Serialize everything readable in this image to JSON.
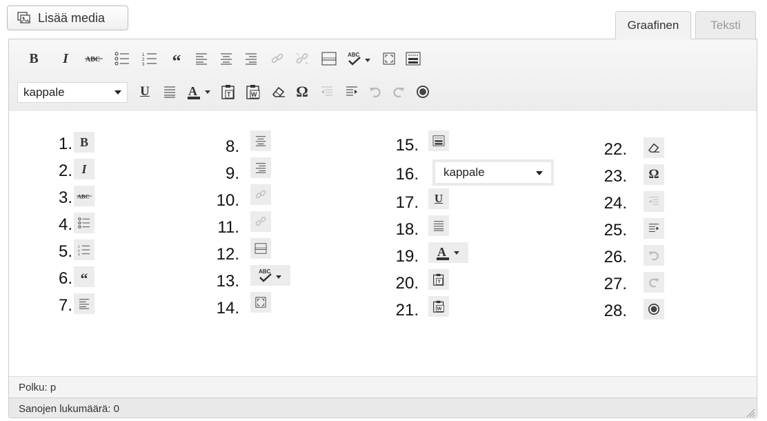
{
  "media_button": {
    "label": "Lisää media",
    "icon": "add-media-icon"
  },
  "tabs": [
    {
      "label": "Graafinen",
      "active": true
    },
    {
      "label": "Teksti",
      "active": false
    }
  ],
  "toolbar": {
    "row1": [
      "bold-icon",
      "italic-icon",
      "strikethrough-icon",
      "bullet-list-icon",
      "numbered-list-icon",
      "blockquote-icon",
      "align-left-icon",
      "align-center-icon",
      "align-right-icon",
      "link-icon",
      "unlink-icon",
      "more-tag-icon",
      "spellcheck-icon",
      "fullscreen-icon",
      "toolbar-toggle-icon"
    ],
    "row2": [
      "format-select",
      "underline-icon",
      "justify-icon",
      "text-color-icon",
      "paste-text-icon",
      "paste-word-icon",
      "clear-formatting-icon",
      "special-character-icon",
      "outdent-icon",
      "indent-icon",
      "undo-icon",
      "redo-icon",
      "help-icon"
    ],
    "format_value": "kappale"
  },
  "legend": {
    "items": [
      {
        "number": "1.",
        "icon": "bold-icon"
      },
      {
        "number": "2.",
        "icon": "italic-icon"
      },
      {
        "number": "3.",
        "icon": "strikethrough-icon"
      },
      {
        "number": "4.",
        "icon": "bullet-list-icon"
      },
      {
        "number": "5.",
        "icon": "numbered-list-icon"
      },
      {
        "number": "6.",
        "icon": "blockquote-icon"
      },
      {
        "number": "7.",
        "icon": "align-left-icon"
      },
      {
        "number": "8.",
        "icon": "align-center-icon"
      },
      {
        "number": "9.",
        "icon": "align-right-icon"
      },
      {
        "number": "10.",
        "icon": "link-icon"
      },
      {
        "number": "11.",
        "icon": "unlink-icon"
      },
      {
        "number": "12.",
        "icon": "more-tag-icon"
      },
      {
        "number": "13.",
        "icon": "spellcheck-icon"
      },
      {
        "number": "14.",
        "icon": "fullscreen-icon"
      },
      {
        "number": "15.",
        "icon": "toolbar-toggle-icon"
      },
      {
        "number": "16.",
        "icon": "format-select",
        "value": "kappale"
      },
      {
        "number": "17.",
        "icon": "underline-icon"
      },
      {
        "number": "18.",
        "icon": "justify-icon"
      },
      {
        "number": "19.",
        "icon": "text-color-icon"
      },
      {
        "number": "20.",
        "icon": "paste-text-icon"
      },
      {
        "number": "21.",
        "icon": "paste-word-icon"
      },
      {
        "number": "22.",
        "icon": "clear-formatting-icon"
      },
      {
        "number": "23.",
        "icon": "special-character-icon"
      },
      {
        "number": "24.",
        "icon": "outdent-icon"
      },
      {
        "number": "25.",
        "icon": "indent-icon"
      },
      {
        "number": "26.",
        "icon": "undo-icon"
      },
      {
        "number": "27.",
        "icon": "redo-icon"
      },
      {
        "number": "28.",
        "icon": "help-icon"
      }
    ]
  },
  "status": {
    "path_label": "Polku: p",
    "word_count_label": "Sanojen lukumäärä: 0"
  }
}
